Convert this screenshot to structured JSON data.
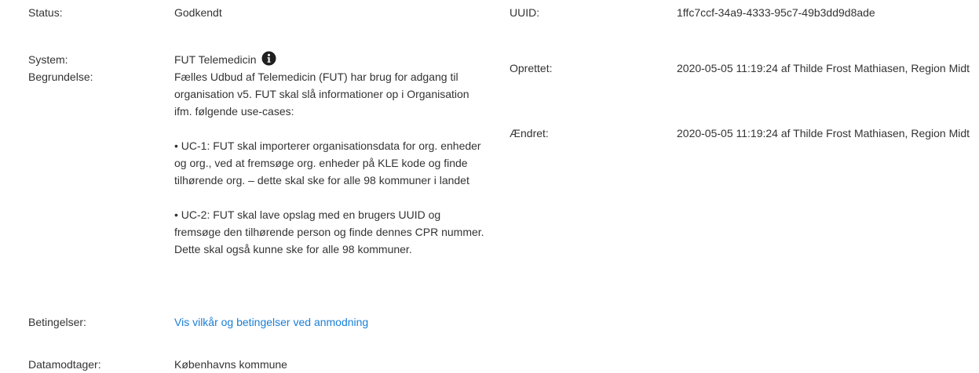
{
  "left": {
    "status": {
      "label": "Status:",
      "value": "Godkendt"
    },
    "system": {
      "label": "System:",
      "value": "FUT Telemedicin"
    },
    "begrundelse": {
      "label": "Begrundelse:",
      "paragraphs": [
        "Fælles Udbud af Telemedicin (FUT) har brug for adgang til organisation v5. FUT skal slå informationer op i Organisation ifm. følgende use-cases:",
        "• UC-1: FUT skal importerer organisationsdata for org. enheder og org., ved at fremsøge org. enheder på KLE kode og finde tilhørende org. – dette skal ske for alle 98 kommuner i landet",
        "• UC-2: FUT skal lave opslag med en brugers UUID og fremsøge den tilhørende person og finde dennes CPR nummer. Dette skal også kunne ske for alle 98 kommuner."
      ]
    },
    "betingelser": {
      "label": "Betingelser:",
      "link": "Vis vilkår og betingelser ved anmodning"
    },
    "datamodtager": {
      "label": "Datamodtager:",
      "value": "Københavns kommune"
    }
  },
  "right": {
    "uuid": {
      "label": "UUID:",
      "value": "1ffc7ccf-34a9-4333-95c7-49b3dd9d8ade"
    },
    "oprettet": {
      "label": "Oprettet:",
      "value": "2020-05-05 11:19:24 af Thilde Frost Mathiasen, Region Midt"
    },
    "aendret": {
      "label": "Ændret:",
      "value": "2020-05-05 11:19:24 af Thilde Frost Mathiasen, Region Midt"
    }
  },
  "icons": {
    "system_info": "info-circle-icon"
  },
  "colors": {
    "text": "#333333",
    "link": "#1a7ed6",
    "icon": "#1f1f1f"
  }
}
